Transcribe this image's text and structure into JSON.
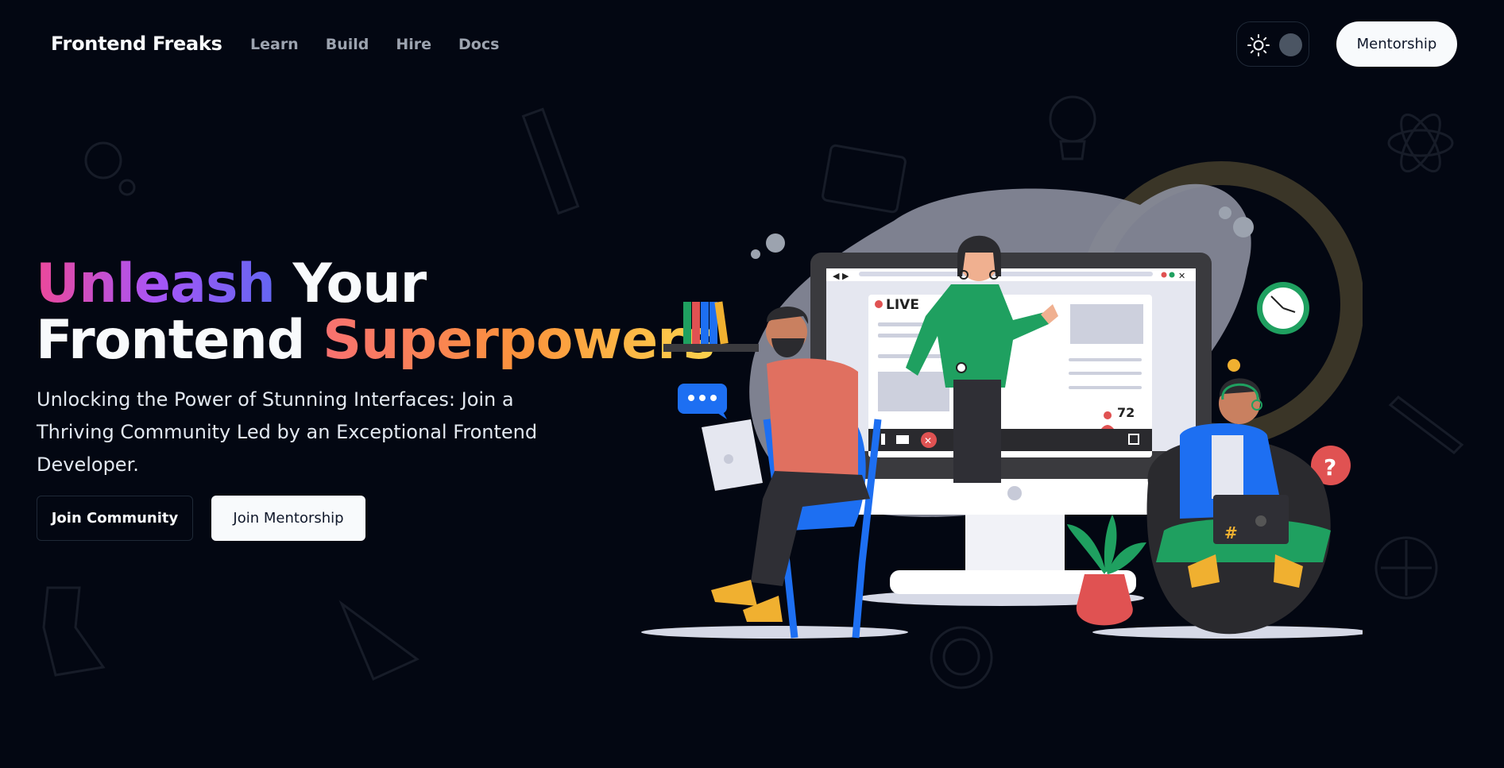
{
  "header": {
    "logo": "Frontend Freaks",
    "nav": [
      "Learn",
      "Build",
      "Hire",
      "Docs"
    ],
    "mentorship_button": "Mentorship"
  },
  "hero": {
    "title_line1_accent": "Unleash",
    "title_line1_rest": "Your",
    "title_line2_start": "Frontend",
    "title_line2_accent": "Superpowers",
    "subtitle": "Unlocking the Power of Stunning Interfaces: Join a Thriving Community Led by an Exceptional Frontend Developer.",
    "buttons": {
      "community": "Join Community",
      "mentorship": "Join Mentorship"
    }
  },
  "illustration": {
    "live_label": "LIVE",
    "viewer_count": "72",
    "hashtag": "#",
    "question_mark": "?"
  },
  "icons": {
    "theme": "sun-icon",
    "toggle": "toggle-knob"
  },
  "colors": {
    "background": "#030712",
    "accent_gradient_1": [
      "#ec4899",
      "#a855f7",
      "#6366f1"
    ],
    "accent_gradient_2": [
      "#f87171",
      "#fb923c",
      "#fcd34d"
    ],
    "primary_button_bg": "#f8fafc"
  }
}
